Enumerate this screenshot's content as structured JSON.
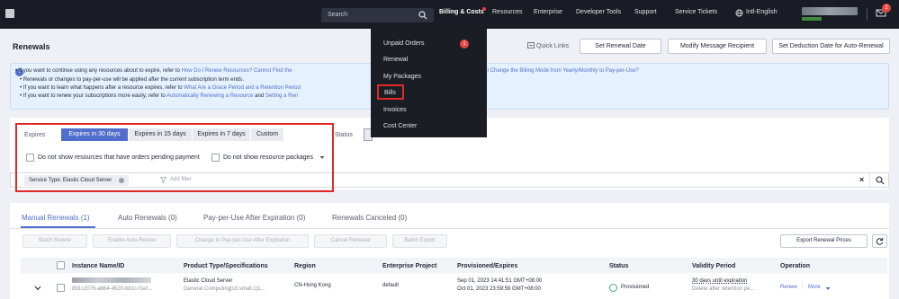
{
  "topbar": {
    "search_placeholder": "Search",
    "nav": [
      {
        "label": "Billing & Costs",
        "active": true
      },
      {
        "label": "Resources"
      },
      {
        "label": "Enterprise"
      },
      {
        "label": "Developer Tools"
      },
      {
        "label": "Support"
      },
      {
        "label": "Service Tickets"
      },
      {
        "label": "Intl-English"
      }
    ],
    "message_badge": "2"
  },
  "header": {
    "title": "Renewals",
    "quick_links": "Quick Links",
    "buttons": [
      "Set Renewal Date",
      "Modify Message Recipient",
      "Set Deduction Date for Auto-Renewal"
    ]
  },
  "info": {
    "lines": [
      {
        "pre": "If you want to continue using any resources about to expire, refer to ",
        "link1": "How Do I Renew Resources? Cannot Find the",
        "mid": "",
        "link2": "lo I Change the Billing Mode from Yearly/Monthly to Pay-per-Use?"
      },
      {
        "pre": "Renewals or changes to pay-per-use will be applied after the current subscription term ends.",
        "link1": "",
        "mid": "",
        "link2": ""
      },
      {
        "pre": "If you want to learn what happens after a resource expires, refer to ",
        "link1": "What Are a Grace Period and a Retention Period",
        "mid": "",
        "link2": ""
      },
      {
        "pre": "If you want to renew your subscriptions more easily, refer to ",
        "link1": "Automatically Renewing a Resource",
        "mid": " and ",
        "link2": "Setting a Ren"
      }
    ]
  },
  "filter": {
    "expires_label": "Expires",
    "tabs": [
      "Expires in 30 days",
      "Expires in 15 days",
      "Expires in 7 days",
      "Custom"
    ],
    "selected_tab": 0,
    "status_label": "Status",
    "hide_pending": "Do not show resources that have orders pending payment",
    "hide_packages": "Do not show resource packages",
    "service_tag": "Service Type: Elastic Cloud Server",
    "add_filter_placeholder": "Add filter"
  },
  "dropdown": {
    "items": [
      {
        "label": "Unpaid Orders",
        "badge": "1"
      },
      {
        "label": "Renewal"
      },
      {
        "label": "My Packages"
      },
      {
        "label": "Bills",
        "highlighted": true
      },
      {
        "label": "Invoices"
      },
      {
        "label": "Cost Center"
      }
    ]
  },
  "lower": {
    "tabs": [
      "Manual Renewals (1)",
      "Auto Renewals (0)",
      "Pay-per-Use After Expiration (0)",
      "Renewals Canceled (0)"
    ],
    "selected_tab": 0,
    "actions": [
      "Batch Renew",
      "Enable Auto-Renew",
      "Change to Pay-per-Use After Expiration",
      "Cancel Renewal",
      "Batch Export"
    ],
    "export_button": "Export Renewal Prices",
    "columns": [
      "Instance Name/ID",
      "Product Type/Specifications",
      "Region",
      "Enterprise Project",
      "Provisioned/Expires",
      "Status",
      "Validity Period",
      "Operation"
    ],
    "rows": [
      {
        "instance_id": "891c2076-a664-4520-b81c-f1ef...",
        "product": "Elastic Cloud Server",
        "spec": "General Computing|s3.small.1|1...",
        "region": "CN-Hong Kong",
        "project": "default",
        "provisioned": "Sep 01, 2023 14:41:51 GMT+08:00",
        "expires": "Oct 01, 2023 23:59:59 GMT+08:00",
        "status": "Provisioned",
        "validity": "30 days until expiration",
        "validity_sub": "Delete after retention pe...",
        "op_renew": "Renew",
        "op_more": "More"
      }
    ]
  },
  "colors": {
    "accent": "#526ecc",
    "topbar": "#191c24",
    "highlight_box": "#e02a2a",
    "success": "#3fb36b"
  }
}
